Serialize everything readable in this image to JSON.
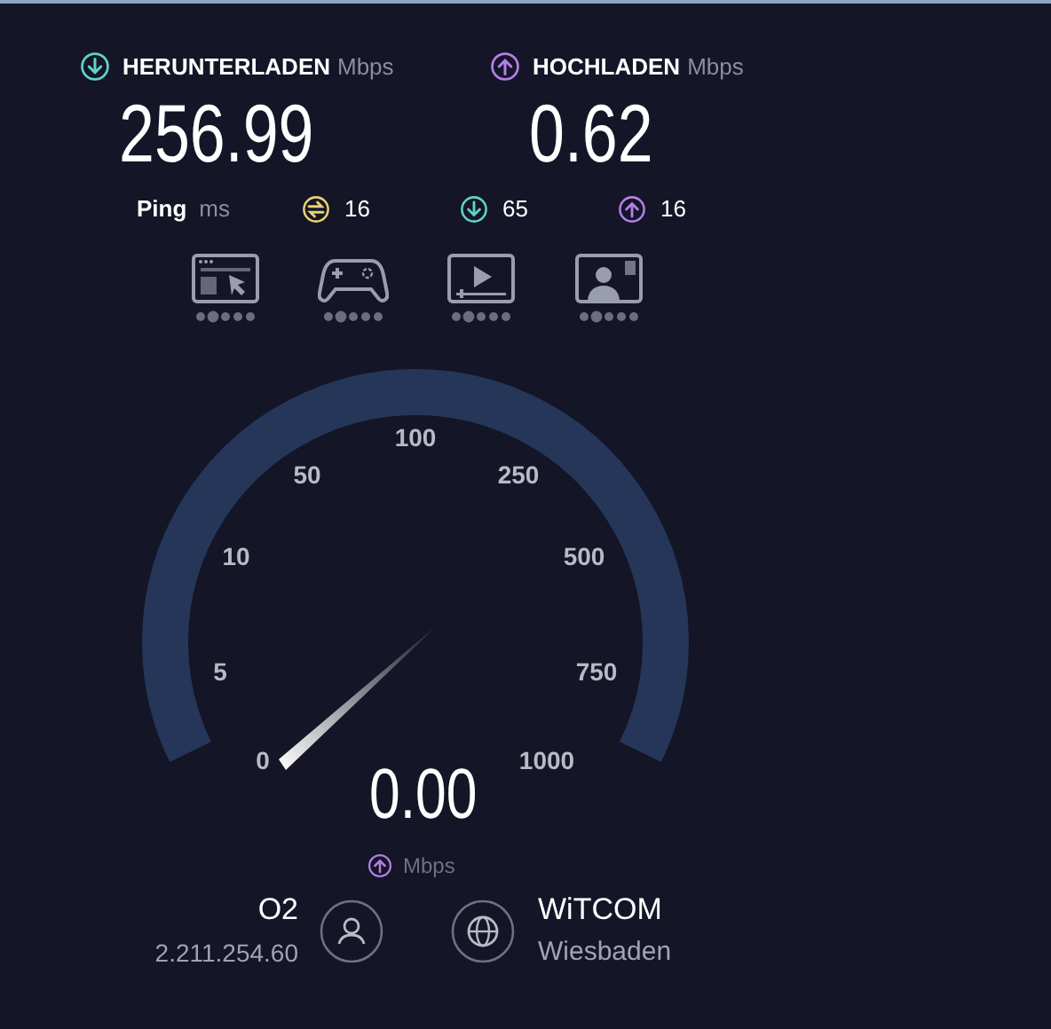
{
  "results": [
    {
      "kind": "download",
      "label": "HERUNTERLADEN",
      "unit": "Mbps",
      "value": "256.99"
    },
    {
      "kind": "upload",
      "label": "HOCHLADEN",
      "unit": "Mbps",
      "value": "0.62"
    }
  ],
  "ping": {
    "label": "Ping",
    "unit": "ms",
    "items": [
      {
        "kind": "idle",
        "value": "16"
      },
      {
        "kind": "download",
        "value": "65"
      },
      {
        "kind": "upload",
        "value": "16"
      }
    ]
  },
  "gauge": {
    "scale": [
      "0",
      "5",
      "10",
      "50",
      "100",
      "250",
      "500",
      "750",
      "1000"
    ],
    "value": "0.00",
    "kind": "upload",
    "unit": "Mbps"
  },
  "provider": {
    "name": "O2",
    "ip": "2.211.254.60"
  },
  "server": {
    "name": "WiTCOM",
    "location": "Wiesbaden"
  }
}
